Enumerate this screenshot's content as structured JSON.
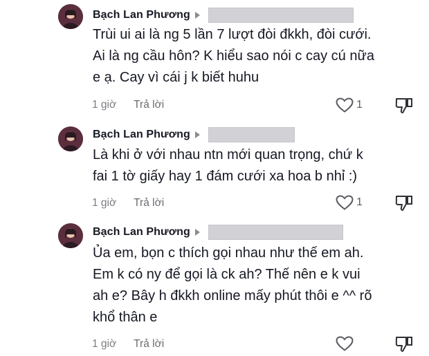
{
  "comments": [
    {
      "author": "Bạch Lan Phương",
      "lines": [
        "Trùi ui ai là ng 5 lần 7 lượt đòi đkkh, đòi cưới.",
        "Ai là ng cầu hôn? K hiểu sao nói c cay cú nữa",
        "e ạ. Cay vì cái j k biết huhu"
      ],
      "time": "1 giờ",
      "reply_label": "Trả lời",
      "like_count": "1"
    },
    {
      "author": "Bạch Lan Phương",
      "lines": [
        "Là khi ở với nhau ntn mới quan trọng, chứ k",
        "fai 1 tờ giấy hay 1 đám cưới xa hoa b nhỉ :)"
      ],
      "time": "1 giờ",
      "reply_label": "Trả lời",
      "like_count": "1"
    },
    {
      "author": "Bạch Lan Phương",
      "lines": [
        "Ủa em, bọn c thích gọi nhau như thế em ah.",
        "Em k có ny để gọi là ck ah? Thế nên e k vui",
        "ah e? Bây h đkkh online mấy phút thôi e ^^ rõ",
        "khổ thân e"
      ],
      "time": "1 giờ",
      "reply_label": "Trả lời",
      "like_count": ""
    }
  ],
  "icons": {
    "avatar": "profile-photo",
    "reply_to": "caret-right-icon",
    "like": "heart-outline-icon",
    "dislike": "thumbs-down-icon"
  },
  "colors": {
    "text": "#161823",
    "meta": "#7b7c82",
    "redaction": "#d2d2d6"
  }
}
